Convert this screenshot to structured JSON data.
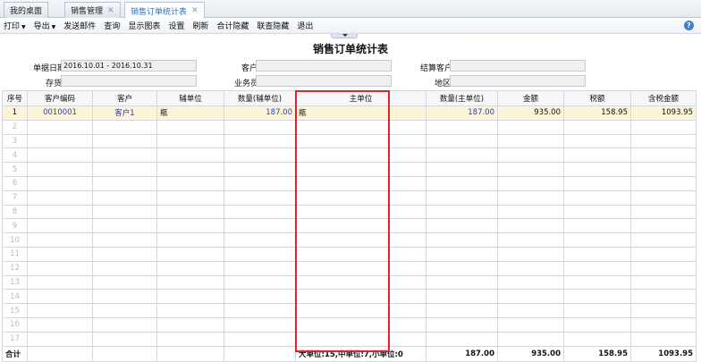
{
  "tabs": [
    {
      "label": "我的桌面",
      "closable": false,
      "active": false
    },
    {
      "label": "销售管理",
      "closable": true,
      "active": false
    },
    {
      "label": "销售订单统计表",
      "closable": true,
      "active": true
    }
  ],
  "toolbar": {
    "items": [
      "打印",
      "导出",
      "发送邮件",
      "查询",
      "显示图表",
      "设置",
      "刷新",
      "合计隐藏",
      "联查隐藏",
      "退出"
    ],
    "dropdown_items": [
      "打印",
      "导出"
    ]
  },
  "report": {
    "title": "销售订单统计表",
    "filters": {
      "date_label": "单据日期",
      "date_value": "2016.10.01 - 2016.10.31",
      "stock_label": "存货",
      "stock_value": "",
      "customer_label": "客户",
      "customer_value": "",
      "salesman_label": "业务员",
      "salesman_value": "",
      "settle_label": "结算客户",
      "settle_value": "",
      "region_label": "地区",
      "region_value": ""
    },
    "columns": [
      "序号",
      "客户编码",
      "客户",
      "辅单位",
      "数量(辅单位)",
      "主单位",
      "数量(主单位)",
      "金额",
      "税额",
      "含税金额"
    ],
    "rows": [
      {
        "idx": "1",
        "code": "0010001",
        "customer": "客户1",
        "aux_unit": "瓶",
        "aux_qty": "187.00",
        "main_unit": "瓶",
        "main_qty": "187.00",
        "amount": "935.00",
        "tax": "158.95",
        "total": "1093.95"
      }
    ],
    "empty_row_indices": [
      "2",
      "3",
      "4",
      "5",
      "6",
      "7",
      "8",
      "9",
      "10",
      "11",
      "12",
      "13",
      "14",
      "15",
      "16",
      "17"
    ],
    "totals": {
      "label": "合计",
      "main_unit": "大单位:15,中单位:7,小单位:0",
      "main_qty": "187.00",
      "amount": "935.00",
      "tax": "158.95",
      "total": "1093.95"
    }
  },
  "colors": {
    "highlight": "#e0232b",
    "active_tab": "#2a72c8",
    "selected_row": "#fdf3d6",
    "link_text": "#2b3fb8"
  }
}
